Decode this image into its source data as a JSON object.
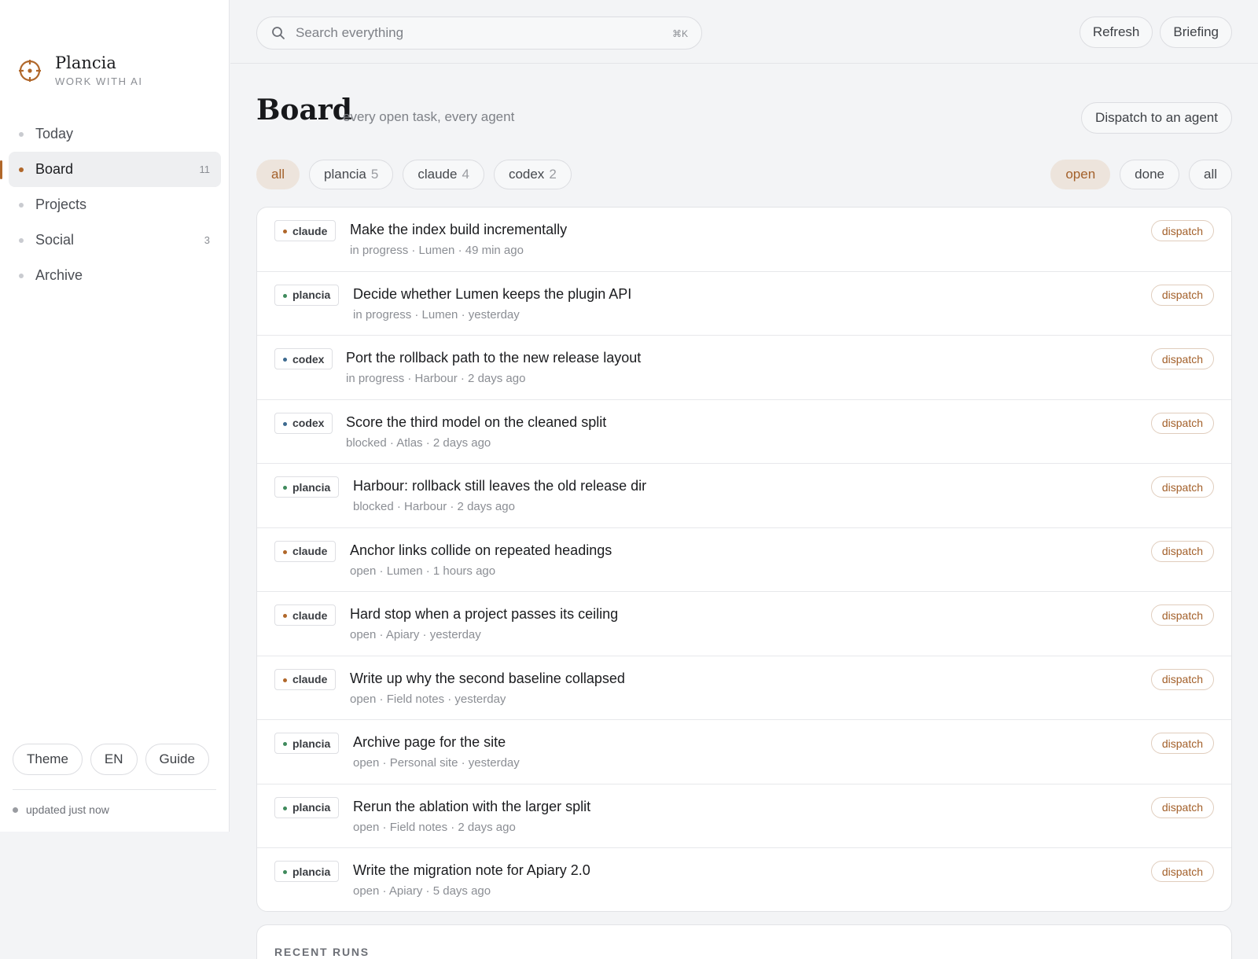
{
  "brand": {
    "name": "Plancia",
    "subtitle": "WORK WITH AI"
  },
  "nav": [
    {
      "label": "Today",
      "count": ""
    },
    {
      "label": "Board",
      "count": "11",
      "active": true
    },
    {
      "label": "Projects",
      "count": ""
    },
    {
      "label": "Social",
      "count": "3"
    },
    {
      "label": "Archive",
      "count": ""
    }
  ],
  "sidebar_footer": {
    "theme_label": "Theme",
    "lang_label": "EN",
    "guide_label": "Guide",
    "status": "updated just now"
  },
  "topbar": {
    "search_placeholder": "Search everything",
    "shortcut": "⌘K",
    "refresh_label": "Refresh",
    "briefing_label": "Briefing"
  },
  "header": {
    "title": "Board",
    "subtitle": "every open task, every agent",
    "dispatch_agent_label": "Dispatch to an agent"
  },
  "filters": {
    "agents": [
      {
        "label": "all",
        "count": "",
        "active": true
      },
      {
        "label": "plancia",
        "count": "5"
      },
      {
        "label": "claude",
        "count": "4"
      },
      {
        "label": "codex",
        "count": "2"
      }
    ],
    "status": [
      {
        "label": "open",
        "active": true
      },
      {
        "label": "done"
      },
      {
        "label": "all"
      }
    ]
  },
  "colors": {
    "accent": "#a3602a",
    "claude_dot": "#b0672a",
    "plancia_dot": "#3f8a5c",
    "codex_dot": "#3d6a8f"
  },
  "tasks": [
    {
      "agent": "claude",
      "title": "Make the index build incrementally",
      "meta": "in progress · Lumen · 49 min ago",
      "action": "dispatch"
    },
    {
      "agent": "plancia",
      "title": "Decide whether Lumen keeps the plugin API",
      "meta": "in progress · Lumen · yesterday",
      "action": "dispatch"
    },
    {
      "agent": "codex",
      "title": "Port the rollback path to the new release layout",
      "meta": "in progress · Harbour · 2 days ago",
      "action": "dispatch"
    },
    {
      "agent": "codex",
      "title": "Score the third model on the cleaned split",
      "meta": "blocked · Atlas · 2 days ago",
      "action": "dispatch"
    },
    {
      "agent": "plancia",
      "title": "Harbour: rollback still leaves the old release dir",
      "meta": "blocked · Harbour · 2 days ago",
      "action": "dispatch"
    },
    {
      "agent": "claude",
      "title": "Anchor links collide on repeated headings",
      "meta": "open · Lumen · 1 hours ago",
      "action": "dispatch"
    },
    {
      "agent": "claude",
      "title": "Hard stop when a project passes its ceiling",
      "meta": "open · Apiary · yesterday",
      "action": "dispatch"
    },
    {
      "agent": "claude",
      "title": "Write up why the second baseline collapsed",
      "meta": "open · Field notes · yesterday",
      "action": "dispatch"
    },
    {
      "agent": "plancia",
      "title": "Archive page for the site",
      "meta": "open · Personal site · yesterday",
      "action": "dispatch"
    },
    {
      "agent": "plancia",
      "title": "Rerun the ablation with the larger split",
      "meta": "open · Field notes · 2 days ago",
      "action": "dispatch"
    },
    {
      "agent": "plancia",
      "title": "Write the migration note for Apiary 2.0",
      "meta": "open · Apiary · 5 days ago",
      "action": "dispatch"
    }
  ],
  "recent": {
    "label": "RECENT RUNS"
  }
}
